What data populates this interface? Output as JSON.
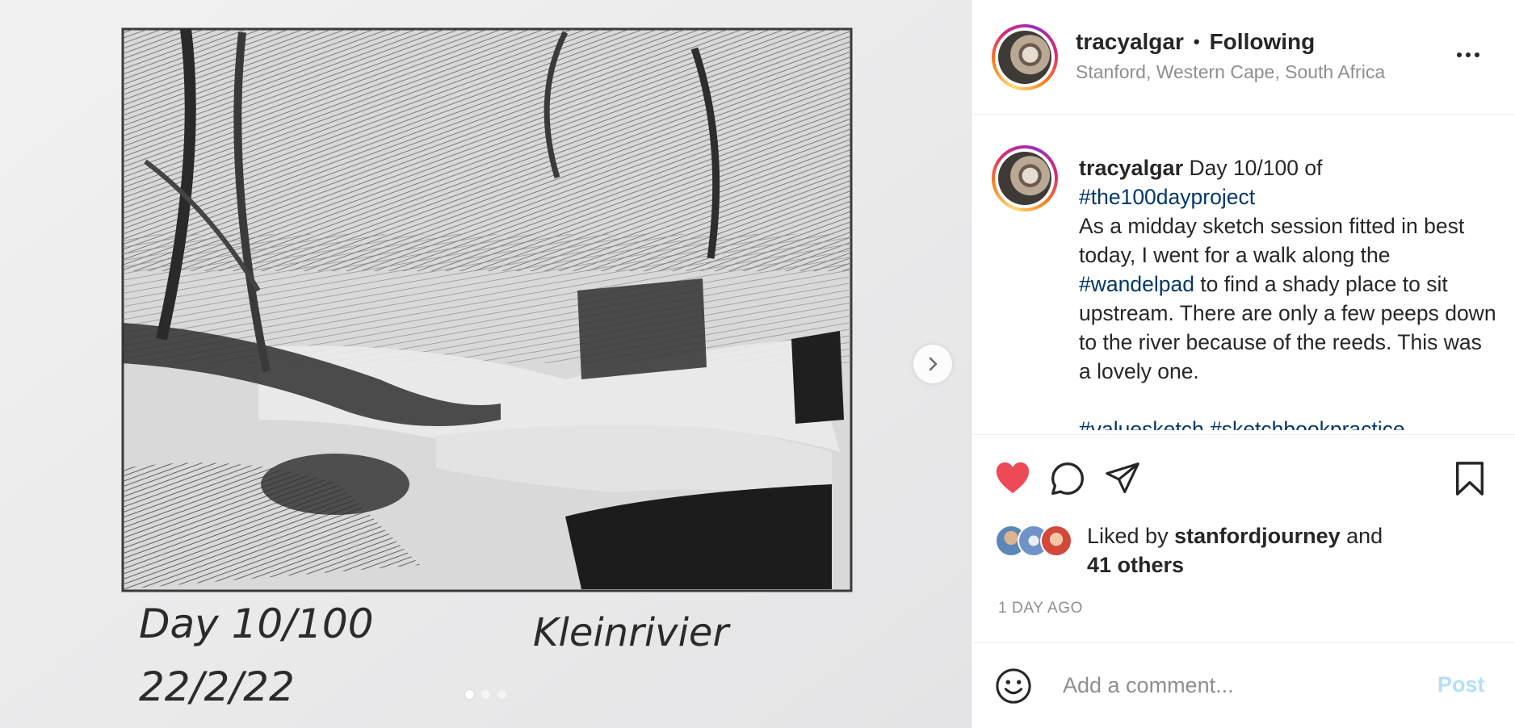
{
  "media": {
    "handwriting_left_1": "Day 10/100",
    "handwriting_left_2": "22/2/22",
    "handwriting_right": "Kleinrivier",
    "carousel_dots": 3,
    "active_dot": 0
  },
  "header": {
    "username": "tracyalgar",
    "bullet": "•",
    "follow_status": "Following",
    "location": "Stanford, Western Cape, South Africa"
  },
  "caption": {
    "username": "tracyalgar",
    "text_1": " Day 10/100 of ",
    "hashtag_1": "#the100dayproject",
    "text_2": "As a midday sketch session fitted in best today, I went for a walk along the ",
    "hashtag_2": "#wandelpad",
    "text_3": " to find a shady place to sit upstream. There are only a few peeps down to the river because of the reeds. This was a lovely one.",
    "hashtag_3": "#valuesketch",
    "hashtag_4": "#sketchbookpractice"
  },
  "actions": {
    "liked": true,
    "likes_prefix": "Liked by ",
    "liked_by_user": "stanfordjourney",
    "likes_and": " and",
    "others": "41 others",
    "timestamp": "1 DAY AGO"
  },
  "comment": {
    "placeholder": "Add a comment...",
    "post_label": "Post"
  },
  "colors": {
    "like_red": "#ed4956",
    "hashtag_blue": "#00376b",
    "post_disabled": "#b2dffc",
    "secondary_text": "#8e8e8e"
  }
}
